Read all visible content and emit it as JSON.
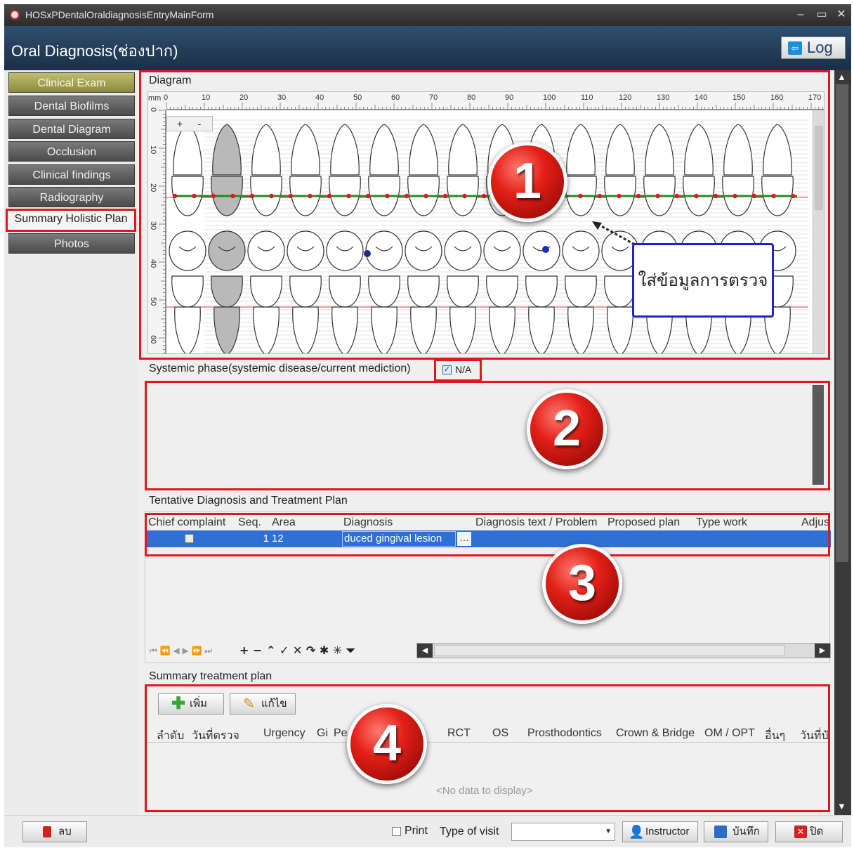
{
  "window": {
    "title": "HOSxPDentalOraldiagnosisEntryMainForm"
  },
  "header": {
    "form_title": "Oral Diagnosis(ช่องปาก)",
    "log_label": "Log"
  },
  "sidebar": {
    "items": [
      {
        "label": "Clinical Exam"
      },
      {
        "label": "Dental Biofilms"
      },
      {
        "label": "Dental Diagram"
      },
      {
        "label": "Occlusion"
      },
      {
        "label": "Clinical findings"
      },
      {
        "label": "Radiography"
      },
      {
        "label": "Summary Holistic Plan"
      },
      {
        "label": "Photos"
      }
    ]
  },
  "diagram": {
    "section_title": "Diagram",
    "ruler_unit": "mm",
    "ruler_h_labels": [
      "0",
      "10",
      "20",
      "30",
      "40",
      "50",
      "60",
      "70",
      "80",
      "90",
      "100",
      "110",
      "120",
      "130",
      "140",
      "150",
      "160",
      "170"
    ],
    "ruler_v_labels": [
      "0",
      "10",
      "20",
      "30",
      "40",
      "50",
      "60"
    ],
    "zoom_in_label": "+",
    "zoom_out_label": "-",
    "callout_text": "ใส่ข้อมูลการตรวจ",
    "badge": "1"
  },
  "systemic": {
    "label": "Systemic phase(systemic disease/current mediction)",
    "na_label": "N/A",
    "na_checked": true,
    "badge": "2"
  },
  "tentative": {
    "section_title": "Tentative Diagnosis and Treatment Plan",
    "columns": [
      "Chief complaint",
      "Seq.",
      "Area",
      "Diagnosis",
      "Diagnosis text / Problem",
      "Proposed plan",
      "Type work",
      "Adjus"
    ],
    "rows": [
      {
        "chief_complaint": false,
        "seq": "1",
        "area": "12",
        "diagnosis": "duced gingival lesion",
        "diagnosis_text": "",
        "proposed_plan": "",
        "type_work": "",
        "adjus": ""
      }
    ],
    "badge": "3"
  },
  "summary": {
    "section_title": "Summary treatment plan",
    "add_label": "เพิ่ม",
    "edit_label": "แก้ไข",
    "columns": [
      "ลำดับ",
      "วันที่ตรวจ",
      "Urgency",
      "Gi",
      "Pe",
      "RCT",
      "OS",
      "Prosthodontics",
      "Crown & Bridge",
      "OM / OPT",
      "อื่นๆ",
      "วันที่บั"
    ],
    "empty_text": "<No data to display>",
    "badge": "4"
  },
  "footer": {
    "delete_label": "ลบ",
    "print_label": "Print",
    "type_of_visit_label": "Type of visit",
    "type_of_visit_value": "",
    "instructor_label": "Instructor",
    "save_label": "บันทึก",
    "close_label": "ปิด"
  }
}
